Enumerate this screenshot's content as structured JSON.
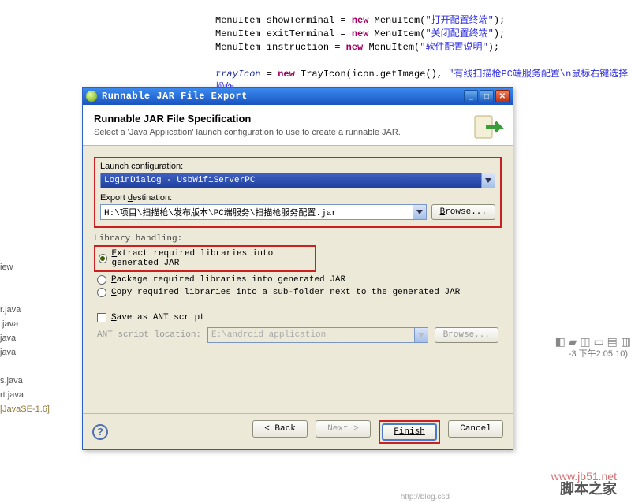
{
  "background": {
    "code_lines": [
      "MenuItem showTerminal = new MenuItem(\"打开配置终端\");",
      "MenuItem exitTerminal = new MenuItem(\"关闭配置终端\");",
      "MenuItem instruction = new MenuItem(\"软件配置说明\");",
      "",
      "trayIcon = new TrayIcon(icon.getImage(), \"有线扫描枪PC端服务配置\\n鼠标右键选择操作"
    ],
    "files": [
      "iew",
      "r.java",
      ".java",
      "java",
      "java",
      "s.java",
      "rt.java",
      "[JavaSE-1.6]"
    ],
    "side_time": "-3 下午2:05:10)"
  },
  "dialog": {
    "title": "Runnable JAR File Export",
    "header": {
      "heading": "Runnable JAR File Specification",
      "subtext": "Select a 'Java Application' launch configuration to use to create a runnable JAR."
    },
    "launch": {
      "label": "Launch configuration:",
      "value": "LoginDialog - UsbWifiServerPC"
    },
    "export": {
      "label": "Export destination:",
      "value": "H:\\项目\\扫描枪\\发布版本\\PC端服务\\扫描枪服务配置.jar",
      "browse": "Browse..."
    },
    "library": {
      "title": "Library handling:",
      "opt1": "Extract required libraries into generated JAR",
      "opt2": "Package required libraries into generated JAR",
      "opt3": "Copy required libraries into a sub-folder next to the generated JAR"
    },
    "ant": {
      "chk_label": "Save as ANT script",
      "loc_label": "ANT script location:",
      "loc_value": "E:\\android_application",
      "browse": "Browse..."
    },
    "buttons": {
      "back": "< Back",
      "next": "Next >",
      "finish": "Finish",
      "cancel": "Cancel"
    }
  },
  "watermark": {
    "site": "脚本之家",
    "url": "www.jb51.net",
    "blog": "http://blog.csd"
  }
}
